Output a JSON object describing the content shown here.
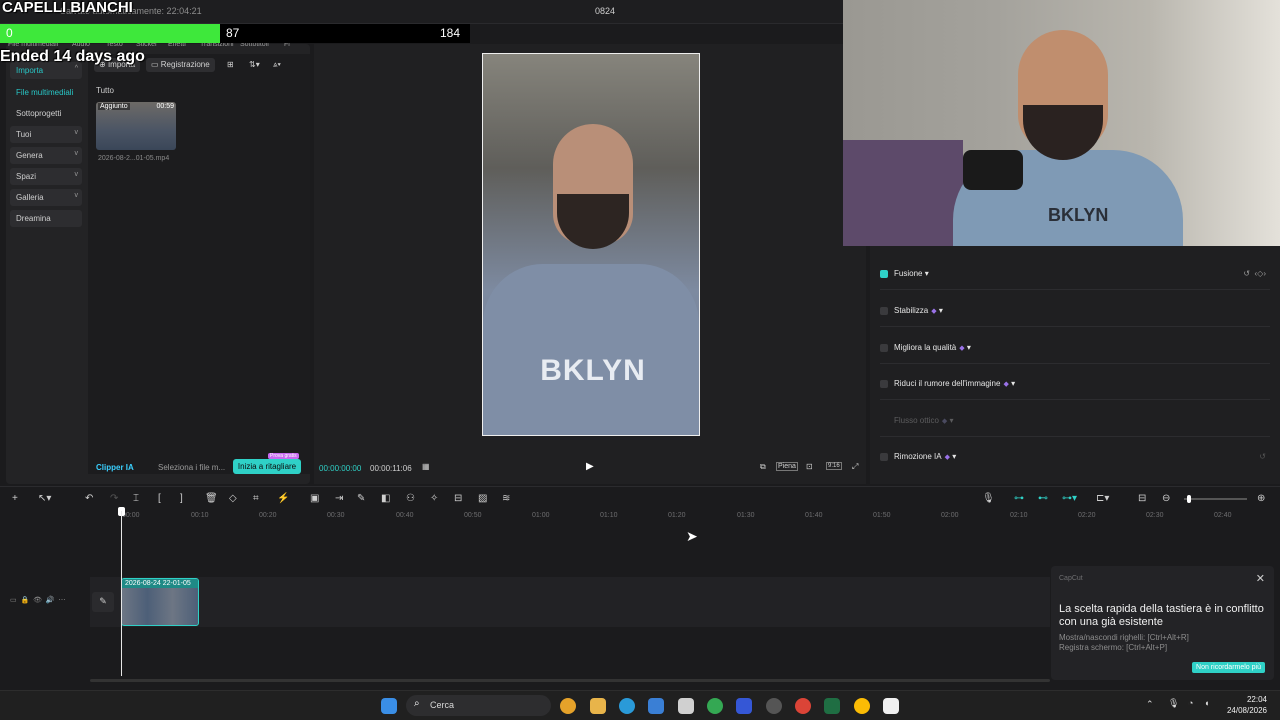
{
  "overlay": {
    "title": "CAPELLI BIANCHI",
    "score_left": "0",
    "score_mid": "87",
    "score_right": "184",
    "status": "Ended 14 days ago",
    "colors": {
      "bar_fill": "#3ee83b",
      "bar_bg": "#000000"
    }
  },
  "topbar": {
    "autosave": "Salvato automaticamente: 22:04:21",
    "project_title": "0824"
  },
  "media_panel": {
    "tabs": [
      "File multimediali",
      "Audio",
      "Testo",
      "Sticker",
      "Effetti",
      "Transizioni",
      "Sottotitoli",
      "Fi"
    ],
    "sidebar": [
      {
        "label": "Importa",
        "chev": "^"
      },
      {
        "label": "File multimediali",
        "chev": ""
      },
      {
        "label": "Sottoprogetti",
        "chev": ""
      },
      {
        "label": "Tuoi",
        "chev": "v"
      },
      {
        "label": "Genera",
        "chev": "v"
      },
      {
        "label": "Spazi",
        "chev": "v"
      },
      {
        "label": "Galleria",
        "chev": "v"
      },
      {
        "label": "Dreamina",
        "chev": ""
      }
    ],
    "import_btn": "Importa",
    "record_btn": "Registrazione",
    "filter_label": "Tutto",
    "thumb": {
      "added": "Aggiunto",
      "duration": "00:59",
      "filename": "2026-08-2...01-05.mp4"
    },
    "clipper_label": "Clipper IA",
    "clipper_hint": "Seleziona i file m...",
    "start_btn": "Inizia a ritagliare",
    "start_badge": "Prova gratis"
  },
  "preview": {
    "video_text": "BKLYN",
    "time_current": "00:00:00:00",
    "time_total": "00:00:11:06",
    "full_label": "Piena",
    "ratio_label": "9:16"
  },
  "webcam": {
    "shirt_text": "BKLYN"
  },
  "properties": {
    "rows": [
      {
        "label": "Fusione",
        "checked": true,
        "ai": false,
        "enabled": true
      },
      {
        "label": "Stabilizza",
        "checked": false,
        "ai": true,
        "enabled": true
      },
      {
        "label": "Migliora la qualità",
        "checked": false,
        "ai": true,
        "enabled": true
      },
      {
        "label": "Riduci il rumore dell'immagine",
        "checked": false,
        "ai": true,
        "enabled": true
      },
      {
        "label": "Flusso ottico",
        "checked": false,
        "ai": true,
        "enabled": false
      },
      {
        "label": "Rimozione IA",
        "checked": false,
        "ai": true,
        "enabled": true
      }
    ]
  },
  "timeline": {
    "ticks": [
      "00:00",
      "00:10",
      "00:20",
      "00:30",
      "00:40",
      "00:50",
      "01:00",
      "01:10",
      "01:20",
      "01:30",
      "01:40",
      "01:50",
      "02:00",
      "02:10",
      "02:20",
      "02:30",
      "02:40"
    ],
    "clip_label": "2026-08-24 22-01-05"
  },
  "toast": {
    "app": "CapCut",
    "title": "La scelta rapida della tastiera è in conflitto con una già esistente",
    "line1": "Mostra/nascondi righelli: [Ctrl+Alt+R]",
    "line2": "Registra schermo: [Ctrl+Alt+P]",
    "button": "Non ricordarmelo più"
  },
  "taskbar": {
    "search": "Cerca",
    "time": "22:04",
    "date": "24/08/2026"
  }
}
